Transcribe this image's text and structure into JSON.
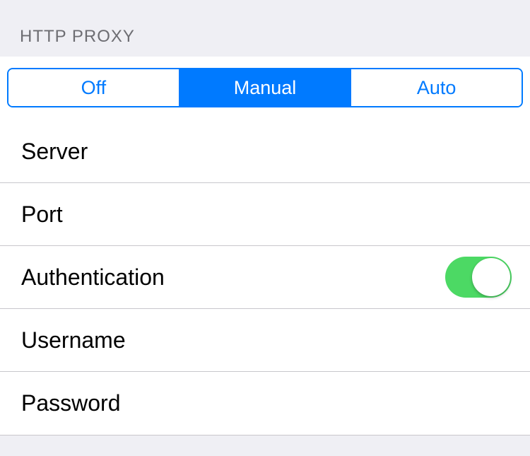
{
  "section": {
    "header": "HTTP PROXY"
  },
  "segments": {
    "off": "Off",
    "manual": "Manual",
    "auto": "Auto",
    "selected": "manual"
  },
  "fields": {
    "server_label": "Server",
    "port_label": "Port",
    "authentication_label": "Authentication",
    "authentication_on": true,
    "username_label": "Username",
    "password_label": "Password"
  }
}
